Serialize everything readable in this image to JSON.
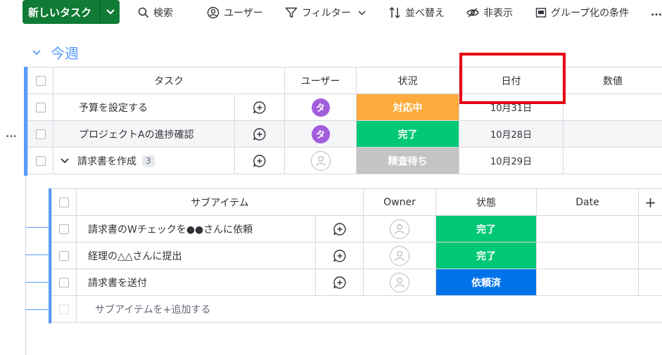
{
  "toolbar": {
    "new_task": "新しいタスク",
    "search": "検索",
    "user": "ユーザー",
    "filter": "フィルター",
    "sort": "並べ替え",
    "hide": "非表示",
    "group_by": "グループ化の条件",
    "more": "..."
  },
  "group": {
    "title": "今週",
    "row_menu": "...",
    "columns": [
      "タスク",
      "ユーザー",
      "状況",
      "日付",
      "数値"
    ],
    "rows": [
      {
        "task": "予算を設定する",
        "user_initial": "タ",
        "status": "対応中",
        "status_color": "#fdab3d",
        "date": "10月31日"
      },
      {
        "task": "プロジェクトAの進捗確認",
        "user_initial": "タ",
        "status": "完了",
        "status_color": "#00c875",
        "date": "10月28日"
      },
      {
        "task": "請求書を作成",
        "subitem_count": "3",
        "user_initial": "",
        "status": "精査待ち",
        "status_color": "#c4c4c4",
        "date": "10月29日"
      }
    ]
  },
  "subitems": {
    "columns": [
      "サブアイテム",
      "Owner",
      "状態",
      "Date",
      "+"
    ],
    "rows": [
      {
        "name": "請求書のWチェックを●●さんに依頼",
        "status": "完了",
        "status_color": "#00c875"
      },
      {
        "name": "経理の△△さんに提出",
        "status": "完了",
        "status_color": "#00c875"
      },
      {
        "name": "請求書を送付",
        "status": "依頼済",
        "status_color": "#0073ea"
      }
    ],
    "add_label": "サブアイテムを+追加する"
  },
  "colors": {
    "brand_green": "#0f7b34",
    "group_blue": "#579bfc",
    "highlight_red": "#e60012"
  },
  "icons": [
    "chevron-down-icon",
    "search-icon",
    "user-icon",
    "filter-icon",
    "sort-icon",
    "eye-off-icon",
    "group-icon",
    "comment-add-icon",
    "empty-avatar-icon"
  ]
}
